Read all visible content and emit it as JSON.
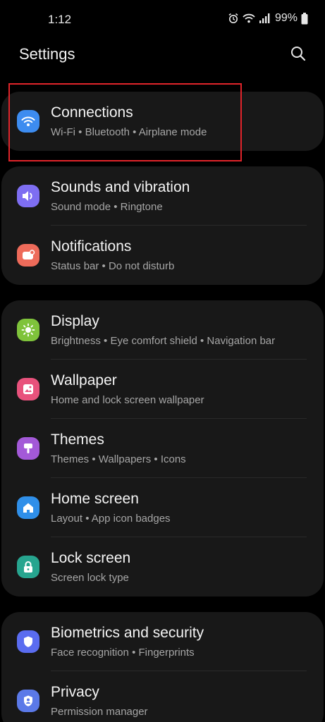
{
  "status": {
    "time": "1:12",
    "battery": "99%"
  },
  "header": {
    "title": "Settings"
  },
  "items": [
    {
      "title": "Connections",
      "sub": "Wi-Fi  •  Bluetooth  •  Airplane mode",
      "icon": "wifi-icon",
      "color": "#3d8cf0"
    },
    {
      "title": "Sounds and vibration",
      "sub": "Sound mode  •  Ringtone",
      "icon": "speaker-icon",
      "color": "#7e6ef2"
    },
    {
      "title": "Notifications",
      "sub": "Status bar  •  Do not disturb",
      "icon": "notification-icon",
      "color": "#ee6b5a"
    },
    {
      "title": "Display",
      "sub": "Brightness  •  Eye comfort shield  •  Navigation bar",
      "icon": "sun-icon",
      "color": "#7fc33b"
    },
    {
      "title": "Wallpaper",
      "sub": "Home and lock screen wallpaper",
      "icon": "wallpaper-icon",
      "color": "#e8527c"
    },
    {
      "title": "Themes",
      "sub": "Themes  •  Wallpapers  •  Icons",
      "icon": "brush-icon",
      "color": "#a359d8"
    },
    {
      "title": "Home screen",
      "sub": "Layout  •  App icon badges",
      "icon": "home-icon",
      "color": "#2f8fe9"
    },
    {
      "title": "Lock screen",
      "sub": "Screen lock type",
      "icon": "lock-icon",
      "color": "#27a58f"
    },
    {
      "title": "Biometrics and security",
      "sub": "Face recognition  •  Fingerprints",
      "icon": "shield-icon",
      "color": "#5a6cf0"
    },
    {
      "title": "Privacy",
      "sub": "Permission manager",
      "icon": "privacy-icon",
      "color": "#5b79e8"
    }
  ]
}
